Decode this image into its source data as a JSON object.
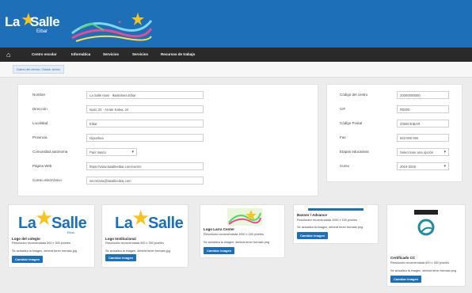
{
  "header": {
    "logo_la": "La",
    "logo_salle": "Salle",
    "logo_sub": "Eibar"
  },
  "nav": {
    "items": [
      "Centro escolar",
      "Informática",
      "Servicios",
      "Servicios",
      "Recursos de trabajo"
    ]
  },
  "breadcrumb": "Datos del centro / Datos centro",
  "form_left": {
    "fields": [
      {
        "label": "Nombre",
        "value": "La Salle Isasi · Ikastetxea Eibar"
      },
      {
        "label": "Dirección",
        "value": "Isasi, 24 · Arrate Kalea, 24"
      },
      {
        "label": "Localidad",
        "value": "Eibar"
      },
      {
        "label": "Provincia",
        "value": "Gipuzkoa"
      },
      {
        "label": "Comunidad autónoma",
        "value": "País Vasco"
      },
      {
        "label": "Página Web",
        "value": "https://www.lasalleeibar.com/centro"
      },
      {
        "label": "Correo electrónico",
        "value": "secretaria@lasalleeibar.com"
      }
    ]
  },
  "form_right": {
    "fields": [
      {
        "label": "Código del centro",
        "value": "20000000000"
      },
      {
        "label": "CIF",
        "value": "R0000"
      },
      {
        "label": "Código Postal",
        "value": "20600 EIBAR"
      },
      {
        "label": "Fax",
        "value": "943 000 000"
      },
      {
        "label": "Etapas educativas",
        "value": "Seleccione una opción"
      },
      {
        "label": "Curso",
        "value": "2019-2020"
      }
    ]
  },
  "cards": [
    {
      "title": "Logo del colegio",
      "text1": "Resolución recomendada 500 x 300 píxeles",
      "text2": "Se actualiza la imagen, deberá tener formato jpg",
      "button": "Cambiar imagen"
    },
    {
      "title": "Logo Institucional",
      "text1": "Resolución recomendada 500 x 300 píxeles",
      "text2": "Se actualiza la imagen, deberá tener formato jpg",
      "button": "Cambiar imagen"
    },
    {
      "title": "Logo Larra Center",
      "text1": "Resolución recomendada 1050 x 150 píxeles",
      "text2": "Se actualiza la imagen, deberá tener formato png",
      "button": "Cambiar imagen"
    },
    {
      "title": "Banner / Advance",
      "text1": "Resolución recomendada 1050 x 150 píxeles",
      "text2": "Se actualiza la imagen, deberá tener formato png",
      "button": "Cambiar imagen"
    },
    {
      "title": "Certificado CC",
      "text1": "Resolución recomendada 500 x 300 píxeles",
      "text2": "Se actualiza la imagen, deberá tener formato png",
      "button": "Cambiar imagen"
    }
  ],
  "colors": {
    "primary": "#1d6fb8",
    "nav": "#2a2a2a",
    "star": "#f6c421"
  }
}
